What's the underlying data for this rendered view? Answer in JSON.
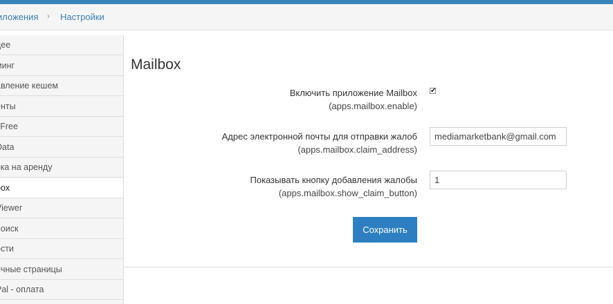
{
  "breadcrumb": {
    "item1": "иложения",
    "separator": "›",
    "item2": "Настройки"
  },
  "sidebar": {
    "items": [
      {
        "label": "дее"
      },
      {
        "label": "минг"
      },
      {
        "label": "авление кешем"
      },
      {
        "label": "енты"
      },
      {
        "label": "l Free"
      },
      {
        "label": "Data"
      },
      {
        "label": "вка на аренду"
      },
      {
        "label": "box",
        "active": true
      },
      {
        "label": "Viewer"
      },
      {
        "label": "поиск"
      },
      {
        "label": "ости"
      },
      {
        "label": "ичные страницы"
      },
      {
        "label": "Pal - оплата"
      }
    ]
  },
  "main": {
    "title": "Mailbox",
    "fields": {
      "enable": {
        "label": "Включить приложение Mailbox",
        "key": "(apps.mailbox.enable)",
        "checked": true
      },
      "claim_address": {
        "label": "Адрес электронной почты для отправки жалоб",
        "key": "(apps.mailbox.claim_address)",
        "value": "mediamarketbank@gmail.com"
      },
      "show_claim_button": {
        "label": "Показывать кнопку добавления жалобы",
        "key": "(apps.mailbox.show_claim_button)",
        "value": "1"
      }
    },
    "save_label": "Сохранить"
  },
  "colors": {
    "topbar": "#3a83b8",
    "link": "#3a7fb0",
    "button": "#2d7fc1"
  }
}
